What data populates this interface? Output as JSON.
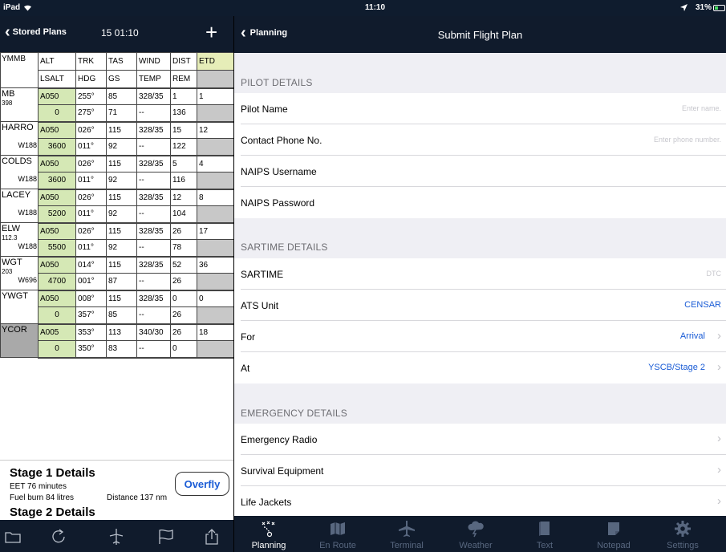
{
  "status_bar": {
    "device": "iPad",
    "time": "11:10",
    "battery": "31%",
    "battery_level": 0.31
  },
  "left_nav": {
    "back_label": "Stored Plans",
    "timer": "15 01:10",
    "add_icon": "plus-icon"
  },
  "plan_table": {
    "headers_top": {
      "wp": "YMMB",
      "alt": "ALT",
      "trk": "TRK",
      "tas": "TAS",
      "wind": "WIND",
      "dist": "DIST",
      "etd": "ETD"
    },
    "headers_bottom": {
      "alt": "LSALT",
      "trk": "HDG",
      "tas": "GS",
      "wind": "TEMP",
      "dist": "REM",
      "etd": ""
    },
    "rows": [
      {
        "name": "MB",
        "sub": "398",
        "subright": "",
        "alt": "A050",
        "trk": "255°",
        "tas": "85",
        "wind": "328/35",
        "dist": "1",
        "etd": "1",
        "lsalt": "0",
        "hdg": "275°",
        "gs": "71",
        "temp": "--",
        "rem": "136"
      },
      {
        "name": "HARRO",
        "sub": "",
        "subright": "W188",
        "alt": "A050",
        "trk": "026°",
        "tas": "115",
        "wind": "328/35",
        "dist": "15",
        "etd": "12",
        "lsalt": "3600",
        "hdg": "011°",
        "gs": "92",
        "temp": "--",
        "rem": "122"
      },
      {
        "name": "COLDS",
        "sub": "",
        "subright": "W188",
        "alt": "A050",
        "trk": "026°",
        "tas": "115",
        "wind": "328/35",
        "dist": "5",
        "etd": "4",
        "lsalt": "3600",
        "hdg": "011°",
        "gs": "92",
        "temp": "--",
        "rem": "116"
      },
      {
        "name": "LACEY",
        "sub": "",
        "subright": "W188",
        "alt": "A050",
        "trk": "026°",
        "tas": "115",
        "wind": "328/35",
        "dist": "12",
        "etd": "8",
        "lsalt": "5200",
        "hdg": "011°",
        "gs": "92",
        "temp": "--",
        "rem": "104"
      },
      {
        "name": "ELW",
        "sub": "112.3",
        "subright": "W188",
        "alt": "A050",
        "trk": "026°",
        "tas": "115",
        "wind": "328/35",
        "dist": "26",
        "etd": "17",
        "lsalt": "5500",
        "hdg": "011°",
        "gs": "92",
        "temp": "--",
        "rem": "78"
      },
      {
        "name": "WGT",
        "sub": "203",
        "subright": "W696",
        "alt": "A050",
        "trk": "014°",
        "tas": "115",
        "wind": "328/35",
        "dist": "52",
        "etd": "36",
        "lsalt": "4700",
        "hdg": "001°",
        "gs": "87",
        "temp": "--",
        "rem": "26"
      },
      {
        "name": "YWGT",
        "sub": "",
        "subright": "",
        "alt": "A050",
        "trk": "008°",
        "tas": "115",
        "wind": "328/35",
        "dist": "0",
        "etd": "0",
        "lsalt": "0",
        "hdg": "357°",
        "gs": "85",
        "temp": "--",
        "rem": "26"
      },
      {
        "name": "YCOR",
        "sub": "",
        "subright": "",
        "alt": "A005",
        "trk": "353°",
        "tas": "113",
        "wind": "340/30",
        "dist": "26",
        "etd": "18",
        "lsalt": "0",
        "hdg": "350°",
        "gs": "83",
        "temp": "--",
        "rem": "0"
      }
    ]
  },
  "stage": {
    "title1": "Stage 1 Details",
    "eet": "EET 76 minutes",
    "fuel": "Fuel burn 84 litres",
    "distance": "Distance 137 nm",
    "title2": "Stage 2 Details",
    "overfly_label": "Overfly"
  },
  "left_toolbar": [
    "folder-icon",
    "refresh-icon",
    "aircraft-icon",
    "flag-icon",
    "share-icon"
  ],
  "right_nav": {
    "back_label": "Planning",
    "title": "Submit Flight Plan"
  },
  "form": {
    "pilot_header": "PILOT DETAILS",
    "pilot_name_label": "Pilot Name",
    "pilot_name_placeholder": "Enter name.",
    "phone_label": "Contact Phone No.",
    "phone_placeholder": "Enter phone number.",
    "naips_user_label": "NAIPS Username",
    "naips_pass_label": "NAIPS Password",
    "sartime_header": "SARTIME DETAILS",
    "sartime_label": "SARTIME",
    "sartime_value": "DTC",
    "ats_label": "ATS Unit",
    "ats_value": "CENSAR",
    "for_label": "For",
    "for_value": "Arrival",
    "at_label": "At",
    "at_value": "YSCB/Stage 2",
    "emergency_header": "EMERGENCY DETAILS",
    "radio_label": "Emergency Radio",
    "survival_label": "Survival Equipment",
    "jackets_label": "Life Jackets"
  },
  "tab_bar": {
    "items": [
      {
        "label": "Planning",
        "icon": "planning-icon"
      },
      {
        "label": "En Route",
        "icon": "map-icon"
      },
      {
        "label": "Terminal",
        "icon": "airplane-icon"
      },
      {
        "label": "Weather",
        "icon": "weather-icon"
      },
      {
        "label": "Text",
        "icon": "book-icon"
      },
      {
        "label": "Notepad",
        "icon": "notepad-icon"
      },
      {
        "label": "Settings",
        "icon": "gear-icon"
      }
    ],
    "active": "Planning"
  },
  "colors": {
    "nav_bg": "#101b2c",
    "accent": "#1a5cd6",
    "alt_cell": "#d5e8b5",
    "etd_cell": "#e6edb8"
  }
}
